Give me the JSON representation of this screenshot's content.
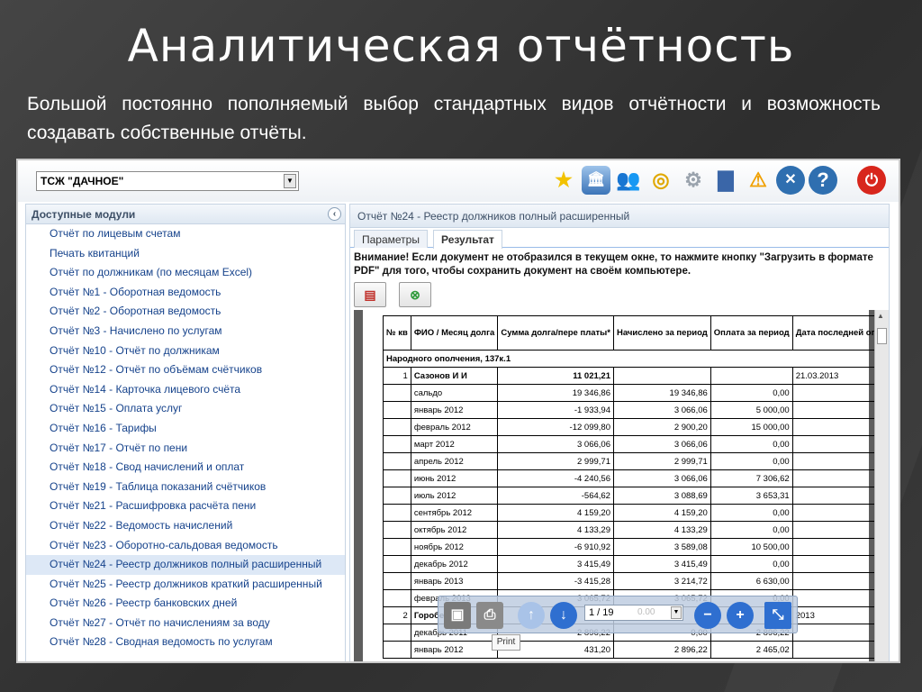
{
  "slide": {
    "title": "Аналитическая отчётность",
    "description": "Большой постоянно пополняемый выбор стандартных видов отчётности и возможность создавать собственные отчёты."
  },
  "app": {
    "org_select": "ТСЖ \"ДАЧНОЕ\"",
    "toolbar_icons": [
      "star-icon",
      "bank-icon",
      "users-icon",
      "coins-icon",
      "gears-icon",
      "chart-icon",
      "warning-icon",
      "tools-icon",
      "help-icon",
      "power-icon"
    ],
    "left_panel": {
      "title": "Доступные модули",
      "items": [
        "Отчёт по лицевым счетам",
        "Печать квитанций",
        "Отчёт по должникам (по месяцам Excel)",
        "Отчёт №1 - Оборотная ведомость",
        "Отчёт №2 - Оборотная ведомость",
        "Отчёт №3 - Начислено по услугам",
        "Отчёт №10 - Отчёт по должникам",
        "Отчёт №12 - Отчёт по объёмам счётчиков",
        "Отчёт №14 - Карточка лицевого счёта",
        "Отчёт №15 - Оплата услуг",
        "Отчёт №16 - Тарифы",
        "Отчёт №17 - Отчёт по пени",
        "Отчёт №18 - Свод начислений и оплат",
        "Отчёт №19 - Таблица показаний счётчиков",
        "Отчёт №21 - Расшифровка расчёта пени",
        "Отчёт №22 - Ведомость начислений",
        "Отчёт №23 - Оборотно-сальдовая ведомость",
        "Отчёт №24 - Реестр должников полный расширенный",
        "Отчёт №25 - Реестр должников краткий расширенный",
        "Отчёт №26 - Реестр банковских дней",
        "Отчёт №27 - Отчёт по начислениям за воду",
        "Отчёт №28 - Сводная ведомость по услугам"
      ],
      "selected_index": 17
    },
    "right_panel": {
      "title": "Отчёт №24 - Реестр должников полный расширенный",
      "tabs": [
        "Параметры",
        "Результат"
      ],
      "active_tab": "Результат",
      "warning": "Внимание! Если документ не отобразился в текущем окне, то нажмите кнопку \"Загрузить в формате PDF\" для того, чтобы сохранить документ на своём компьютере.",
      "buttons": [
        "pdf-icon",
        "excel-icon"
      ]
    },
    "report": {
      "headers": [
        "№ кв",
        "ФИО / Месяц долга",
        "Сумма долга/пере платы*",
        "Начислено за период",
        "Оплата за период",
        "Дата последней оплаты"
      ],
      "group": "Народного ополчения, 137к.1",
      "rows": [
        [
          "1",
          "Сазонов И И",
          "11 021,21",
          "",
          "",
          "21.03.2013"
        ],
        [
          "",
          "сальдо",
          "19 346,86",
          "19 346,86",
          "0,00",
          ""
        ],
        [
          "",
          "январь 2012",
          "-1 933,94",
          "3 066,06",
          "5 000,00",
          ""
        ],
        [
          "",
          "февраль 2012",
          "-12 099,80",
          "2 900,20",
          "15 000,00",
          ""
        ],
        [
          "",
          "март 2012",
          "3 066,06",
          "3 066,06",
          "0,00",
          ""
        ],
        [
          "",
          "апрель 2012",
          "2 999,71",
          "2 999,71",
          "0,00",
          ""
        ],
        [
          "",
          "июнь 2012",
          "-4 240,56",
          "3 066,06",
          "7 306,62",
          ""
        ],
        [
          "",
          "июль 2012",
          "-564,62",
          "3 088,69",
          "3 653,31",
          ""
        ],
        [
          "",
          "сентябрь 2012",
          "4 159,20",
          "4 159,20",
          "0,00",
          ""
        ],
        [
          "",
          "октябрь 2012",
          "4 133,29",
          "4 133,29",
          "0,00",
          ""
        ],
        [
          "",
          "ноябрь 2012",
          "-6 910,92",
          "3 589,08",
          "10 500,00",
          ""
        ],
        [
          "",
          "декабрь 2012",
          "3 415,49",
          "3 415,49",
          "0,00",
          ""
        ],
        [
          "",
          "январь 2013",
          "-3 415,28",
          "3 214,72",
          "6 630,00",
          ""
        ],
        [
          "",
          "февраль 2013",
          "3 065,72",
          "3 065,72",
          "0,00",
          ""
        ],
        [
          "2",
          "Горобец",
          "",
          "",
          "",
          "2013"
        ],
        [
          "",
          "декабрь 2011",
          "-2 896,22",
          "0,00",
          "2 896,22",
          ""
        ],
        [
          "",
          "январь 2012",
          "431,20",
          "2 896,22",
          "2 465,02",
          ""
        ]
      ]
    },
    "pdf_toolbar": {
      "page": "1 / 19",
      "zoom": "0.00",
      "tooltip": "Print"
    }
  }
}
